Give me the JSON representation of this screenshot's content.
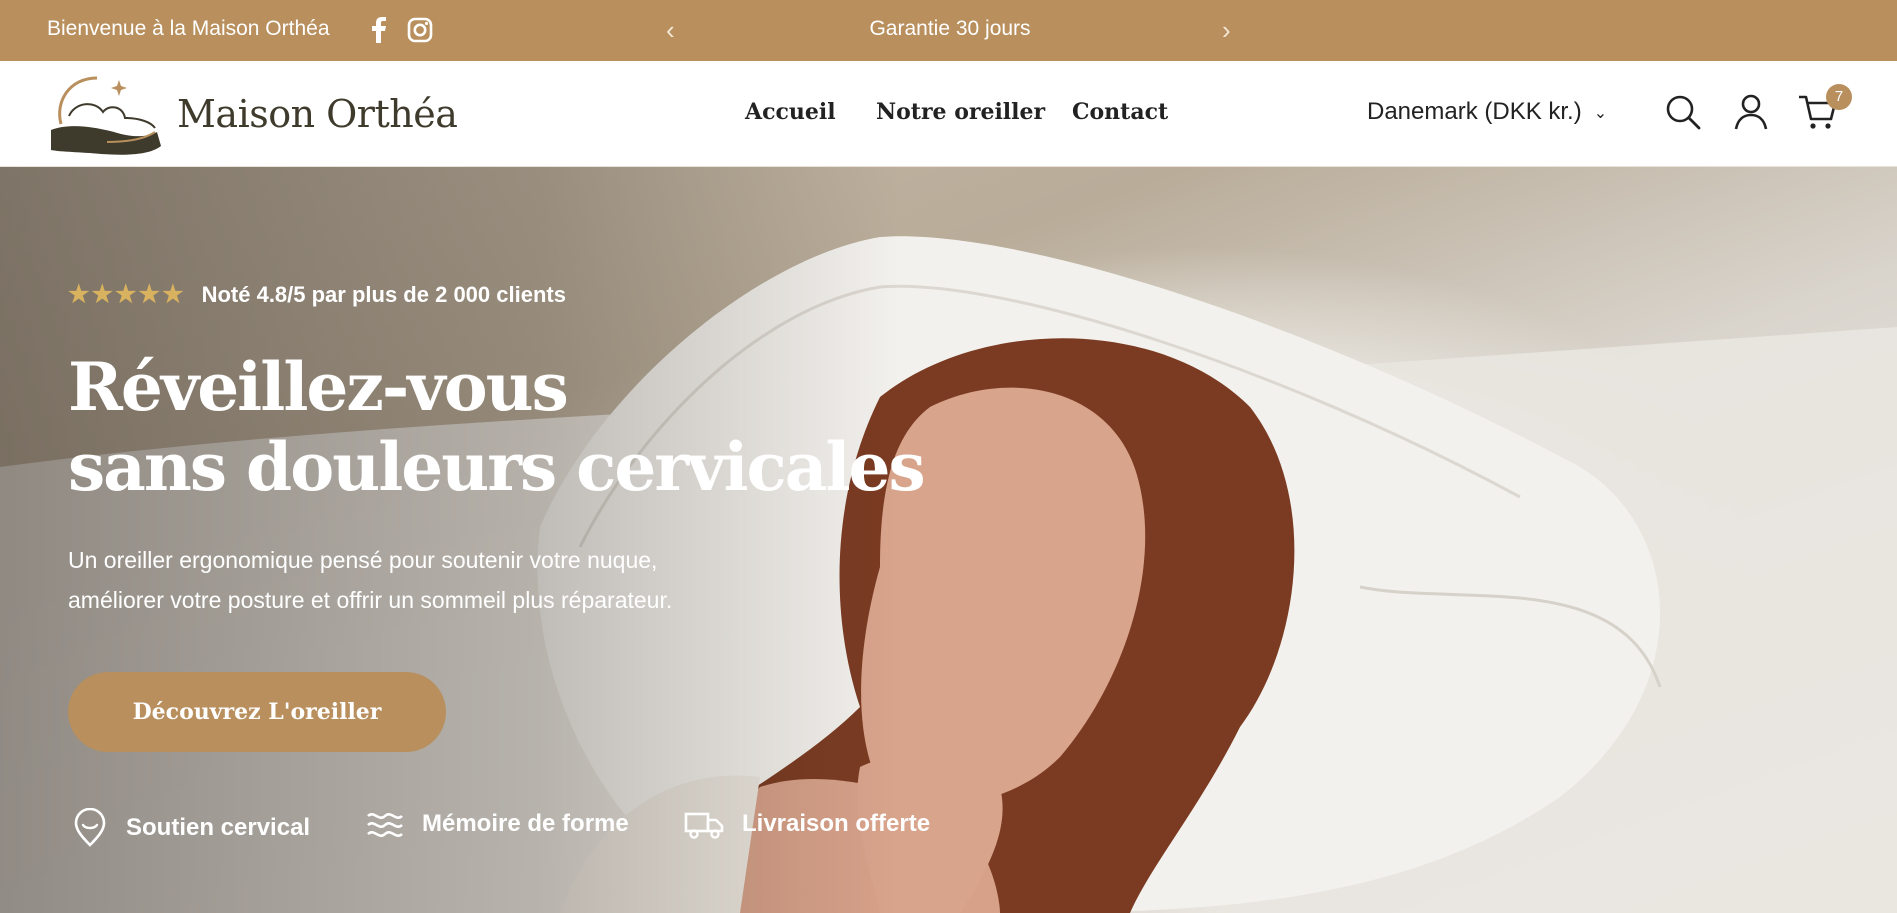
{
  "topbar": {
    "welcome": "Bienvenue à la Maison Orthéa",
    "promo": "Garantie 30 jours",
    "icons": {
      "facebook": "facebook-icon",
      "instagram": "instagram-icon",
      "prev": "chevron-left-icon",
      "next": "chevron-right-icon"
    }
  },
  "header": {
    "logo_text": "Maison Orthéa",
    "nav": [
      "Accueil",
      "Notre oreiller",
      "Contact"
    ],
    "currency": "Danemark (DKK kr.)",
    "cart_count": "7",
    "icons": {
      "search": "search-icon",
      "account": "user-icon",
      "cart": "cart-icon"
    }
  },
  "hero": {
    "rating_text": "Noté 4.8/5 par plus de 2 000 clients",
    "stars": 5,
    "headline_line1": "Réveillez-vous",
    "headline_line2": "sans douleurs cervicales",
    "subtitle_line1": "Un oreiller ergonomique pensé pour soutenir votre nuque,",
    "subtitle_line2": "améliorer votre posture et offrir un sommeil plus réparateur.",
    "cta": "Découvrez L'oreiller",
    "features": [
      {
        "label": "Soutien cervical",
        "icon": "location-pin-icon"
      },
      {
        "label": "Mémoire de forme",
        "icon": "waves-icon"
      },
      {
        "label": "Livraison offerte",
        "icon": "truck-icon"
      }
    ]
  },
  "colors": {
    "accent": "#b88f5d",
    "text_dark": "#222222",
    "star": "#d8b25f"
  }
}
